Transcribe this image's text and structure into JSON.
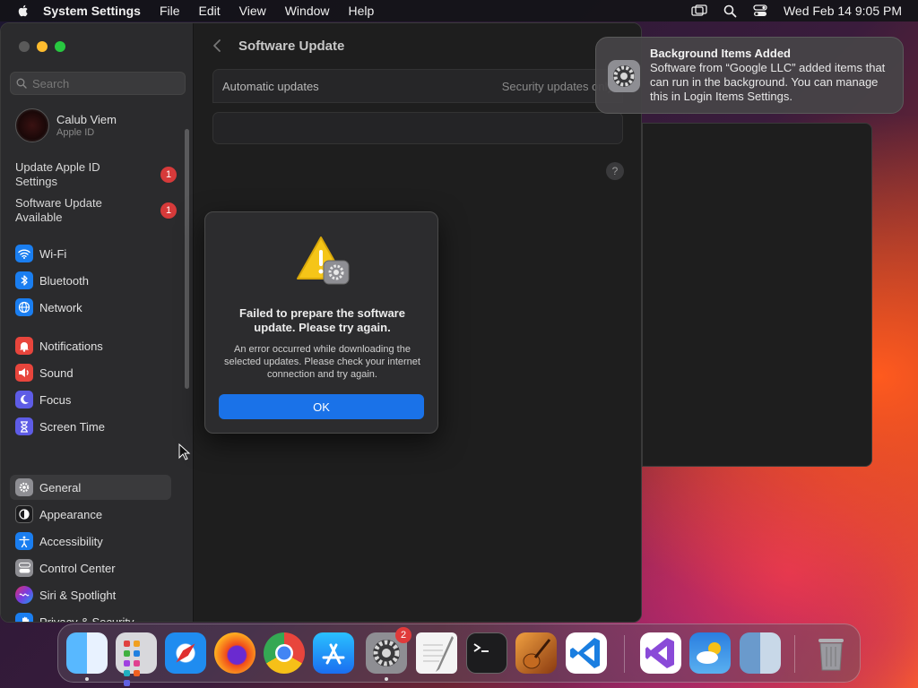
{
  "menubar": {
    "app_name": "System Settings",
    "menus": [
      "File",
      "Edit",
      "View",
      "Window",
      "Help"
    ],
    "clock": "Wed Feb 14  9:05 PM"
  },
  "sidebar": {
    "search_placeholder": "Search",
    "account": {
      "name": "Calub Viem",
      "subtitle": "Apple ID"
    },
    "notices": [
      {
        "label": "Update Apple ID Settings",
        "badge": "1"
      },
      {
        "label": "Software Update Available",
        "badge": "1"
      }
    ],
    "items": [
      {
        "label": "Wi-Fi",
        "icon": "wifi-icon",
        "color": "#1a7ef0"
      },
      {
        "label": "Bluetooth",
        "icon": "bluetooth-icon",
        "color": "#1a7ef0"
      },
      {
        "label": "Network",
        "icon": "globe-icon",
        "color": "#1a7ef0"
      },
      {
        "label": "Notifications",
        "icon": "bell-icon",
        "color": "#e8453c"
      },
      {
        "label": "Sound",
        "icon": "speaker-icon",
        "color": "#e8453c"
      },
      {
        "label": "Focus",
        "icon": "moon-icon",
        "color": "#5e5ce6"
      },
      {
        "label": "Screen Time",
        "icon": "hourglass-icon",
        "color": "#5e5ce6"
      },
      {
        "label": "General",
        "icon": "gear-icon",
        "color": "#8e8e93"
      },
      {
        "label": "Appearance",
        "icon": "appearance-icon",
        "color": "#1c1c1e"
      },
      {
        "label": "Accessibility",
        "icon": "accessibility-icon",
        "color": "#1a7ef0"
      },
      {
        "label": "Control Center",
        "icon": "control-center-icon",
        "color": "#8e8e93"
      },
      {
        "label": "Siri & Spotlight",
        "icon": "siri-icon",
        "color": "#b44ce0"
      },
      {
        "label": "Privacy & Security",
        "icon": "hand-icon",
        "color": "#1a7ef0"
      }
    ],
    "selected": "General"
  },
  "content": {
    "title": "Software Update",
    "automatic_updates_label": "Automatic updates",
    "automatic_updates_value": "Security updates only",
    "help": "?"
  },
  "alert": {
    "title": "Failed to prepare the software update. Please try again.",
    "body": "An error occurred while downloading the selected updates. Please check your internet connection and try again.",
    "button": "OK"
  },
  "notification": {
    "title": "Background Items Added",
    "body": "Software from “Google LLC” added items that can run in the background. You can manage this in Login Items Settings."
  },
  "dock": {
    "apps": [
      {
        "name": "Finder",
        "color": "#2a8ef0",
        "running": true
      },
      {
        "name": "Launchpad",
        "color": "#d8d8dc",
        "running": false
      },
      {
        "name": "Safari",
        "color": "#1f8cf0",
        "running": false
      },
      {
        "name": "Firefox",
        "color": "#f06a1a",
        "running": false
      },
      {
        "name": "Chrome",
        "color": "#ffffff",
        "running": false
      },
      {
        "name": "App Store",
        "color": "#1a7ef0",
        "running": false
      },
      {
        "name": "System Settings",
        "color": "#8e8e93",
        "running": true,
        "badge": "2"
      },
      {
        "name": "TextEdit",
        "color": "#f4f4f4",
        "running": false
      },
      {
        "name": "Terminal",
        "color": "#1c1c1e",
        "running": false
      },
      {
        "name": "GarageBand",
        "color": "#c2702a",
        "running": false
      },
      {
        "name": "Visual Studio Code",
        "color": "#ffffff",
        "running": false
      },
      {
        "name": "Visual Studio",
        "color": "#ffffff",
        "running": false
      },
      {
        "name": "Weather",
        "color": "#2a7ee0",
        "running": false
      },
      {
        "name": "Preview",
        "color": "#6a9acc",
        "running": false
      },
      {
        "name": "Trash",
        "color": "#9a9aa0",
        "running": false
      }
    ]
  }
}
